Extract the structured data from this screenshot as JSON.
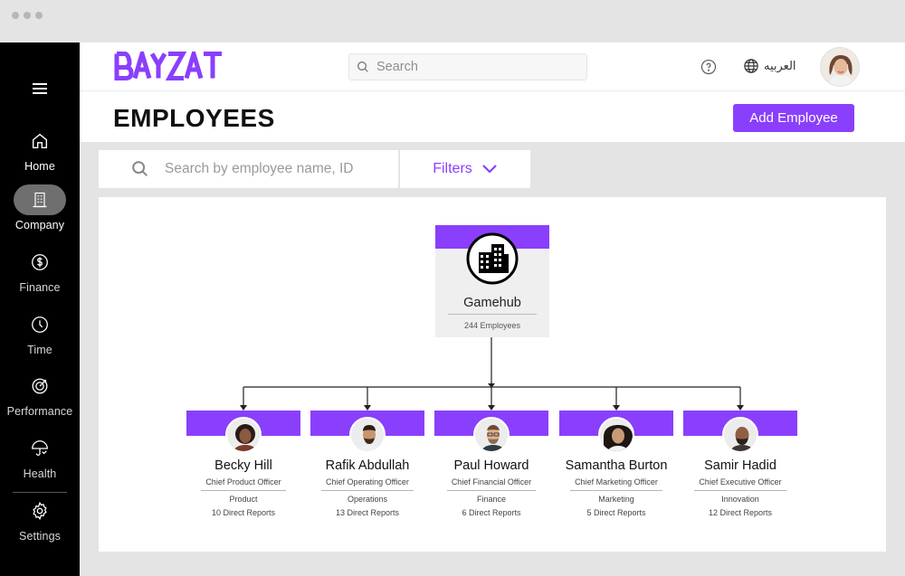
{
  "brand": {
    "logo_text": "BAYZAT",
    "accent": "#8a3ffc"
  },
  "sidebar": {
    "items": [
      {
        "label": "Home",
        "icon": "home-icon"
      },
      {
        "label": "Company",
        "icon": "building-icon"
      },
      {
        "label": "Finance",
        "icon": "dollar-icon"
      },
      {
        "label": "Time",
        "icon": "clock-icon"
      },
      {
        "label": "Performance",
        "icon": "target-icon"
      },
      {
        "label": "Health",
        "icon": "umbrella-icon"
      },
      {
        "label": "Settings",
        "icon": "gear-icon"
      }
    ]
  },
  "header": {
    "search_placeholder": "Search",
    "language_label": "العربيه"
  },
  "page": {
    "title": "EMPLOYEES",
    "add_button": "Add Employee",
    "employee_search_placeholder": "Search by employee name, ID",
    "filters_label": "Filters"
  },
  "org": {
    "name": "Gamehub",
    "employees": "244 Employees",
    "executives": [
      {
        "name": "Becky Hill",
        "title": "Chief Product Officer",
        "department": "Product",
        "reports": "10 Direct Reports"
      },
      {
        "name": "Rafik Abdullah",
        "title": "Chief Operating Officer",
        "department": "Operations",
        "reports": "13 Direct Reports"
      },
      {
        "name": "Paul Howard",
        "title": "Chief Financial Officer",
        "department": "Finance",
        "reports": "6 Direct Reports"
      },
      {
        "name": "Samantha Burton",
        "title": "Chief Marketing Officer",
        "department": "Marketing",
        "reports": "5 Direct Reports"
      },
      {
        "name": "Samir Hadid",
        "title": "Chief Executive Officer",
        "department": "Innovation",
        "reports": "12 Direct Reports"
      }
    ]
  }
}
